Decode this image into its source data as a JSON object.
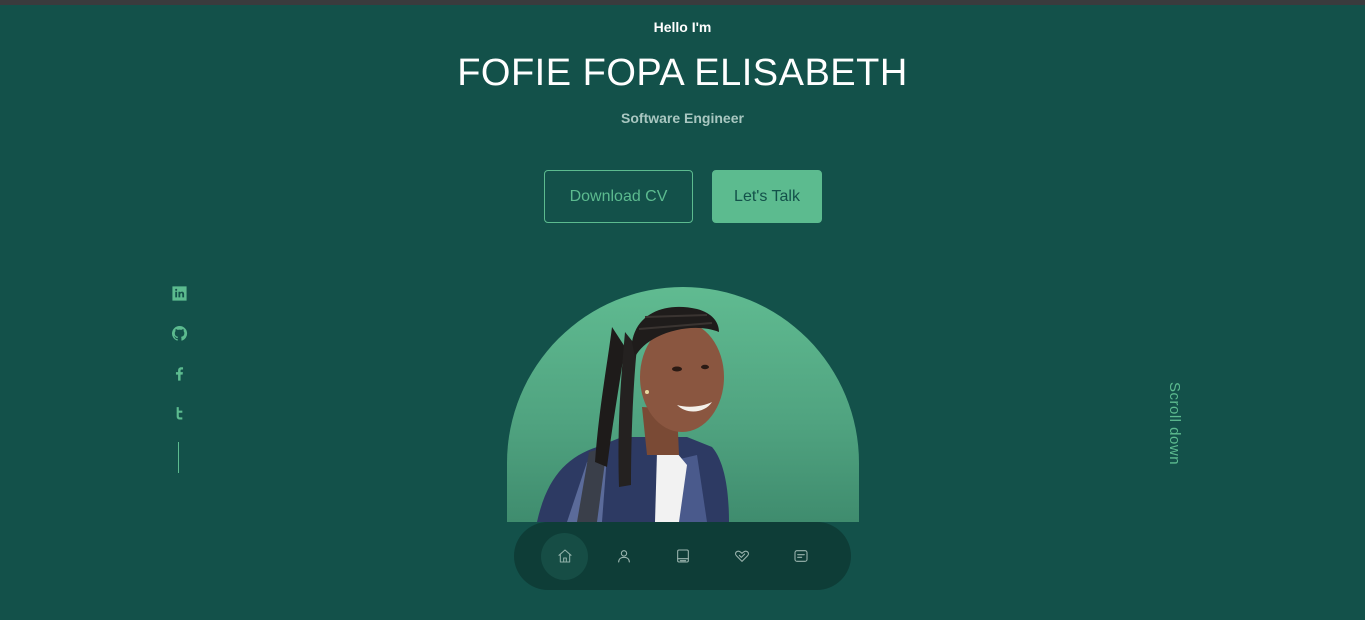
{
  "hero": {
    "greeting": "Hello I'm",
    "name": "FOFIE FOPA ELISABETH",
    "role": "Software Engineer"
  },
  "buttons": {
    "download_cv": "Download CV",
    "lets_talk": "Let's Talk"
  },
  "socials": [
    {
      "icon": "linkedin-icon"
    },
    {
      "icon": "github-icon"
    },
    {
      "icon": "facebook-icon"
    },
    {
      "icon": "twitter-icon"
    }
  ],
  "scroll_label": "Scroll down",
  "nav": [
    {
      "icon": "home-icon",
      "active": true
    },
    {
      "icon": "user-icon",
      "active": false
    },
    {
      "icon": "book-icon",
      "active": false
    },
    {
      "icon": "handshake-icon",
      "active": false
    },
    {
      "icon": "message-icon",
      "active": false
    }
  ],
  "colors": {
    "background": "#13514a",
    "accent": "#5cbb8f",
    "nav_background": "#0e3d37",
    "muted_text": "#a9c7c1"
  }
}
